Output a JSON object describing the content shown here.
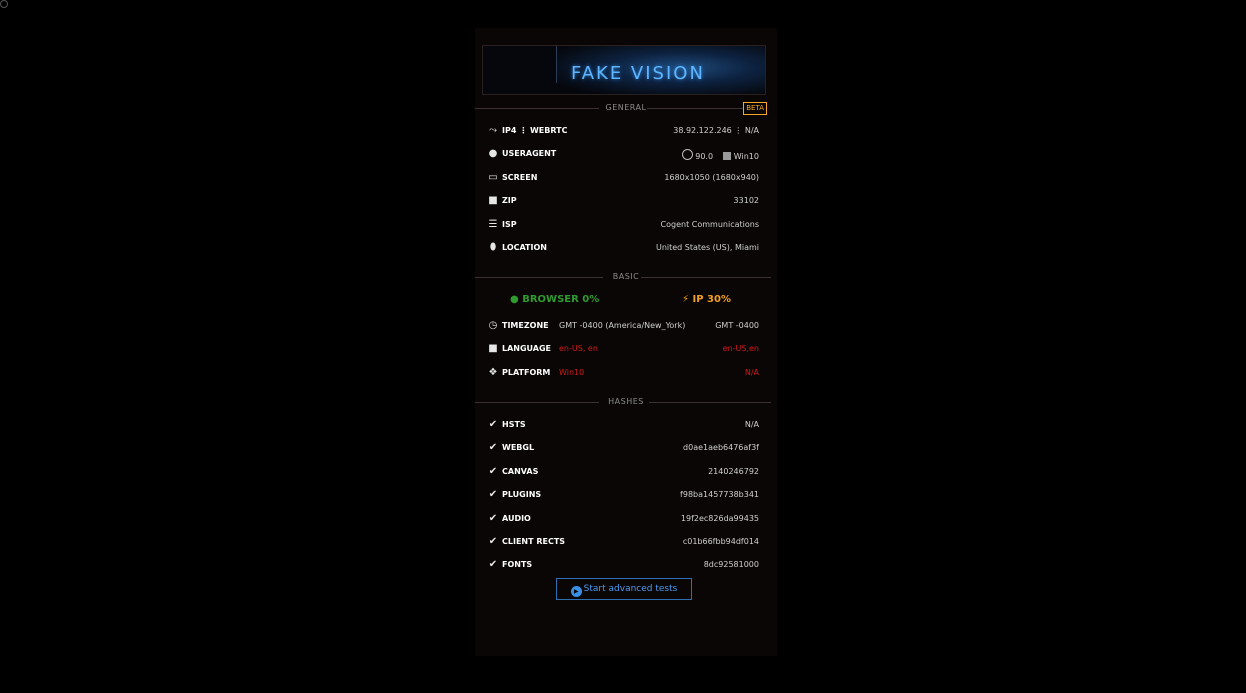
{
  "logo": {
    "text": "FAKE VISION"
  },
  "general": {
    "title": "GENERAL",
    "badge": "BETA",
    "rows": [
      {
        "icon": "share-icon",
        "label": "IP4 ⋮ WEBRTC",
        "value": "38.92.122.246  ⋮ N/A"
      },
      {
        "icon": "user-icon",
        "label": "USERAGENT",
        "value": "90.0",
        "value2": "Win10"
      },
      {
        "icon": "monitor-icon",
        "label": "SCREEN",
        "value": "1680x1050 (1680x940)"
      },
      {
        "icon": "truck-icon",
        "label": "ZIP",
        "value": "33102"
      },
      {
        "icon": "server-icon",
        "label": "ISP",
        "value": "Cogent Communications"
      },
      {
        "icon": "map-pin-icon",
        "label": "LOCATION",
        "value": "United States (US), Miami"
      }
    ]
  },
  "basic": {
    "title": "BASIC",
    "browser_score": "BROWSER 0%",
    "ip_score": "IP 30%",
    "rows": [
      {
        "icon": "clock-icon",
        "label": "TIMEZONE",
        "browser": "GMT -0400 (America/New_York)",
        "ip": "GMT -0400"
      },
      {
        "icon": "truck-icon",
        "label": "LANGUAGE",
        "browser": "en-US, en",
        "ip": "en-US,en"
      },
      {
        "icon": "cubes-icon",
        "label": "PLATFORM",
        "browser": "Win10",
        "ip": "N/A"
      }
    ]
  },
  "hashes": {
    "title": "HASHES",
    "rows": [
      {
        "label": "HSTS",
        "value": "N/A"
      },
      {
        "label": "WEBGL",
        "value": "d0ae1aeb6476af3f"
      },
      {
        "label": "CANVAS",
        "value": "2140246792"
      },
      {
        "label": "PLUGINS",
        "value": "f98ba1457738b341"
      },
      {
        "label": "AUDIO",
        "value": "19f2ec826da99435"
      },
      {
        "label": "CLIENT RECTS",
        "value": "c01b66fbb94df014"
      },
      {
        "label": "FONTS",
        "value": "8dc92581000"
      }
    ]
  },
  "actions": {
    "advanced_tests": "Start advanced tests"
  }
}
